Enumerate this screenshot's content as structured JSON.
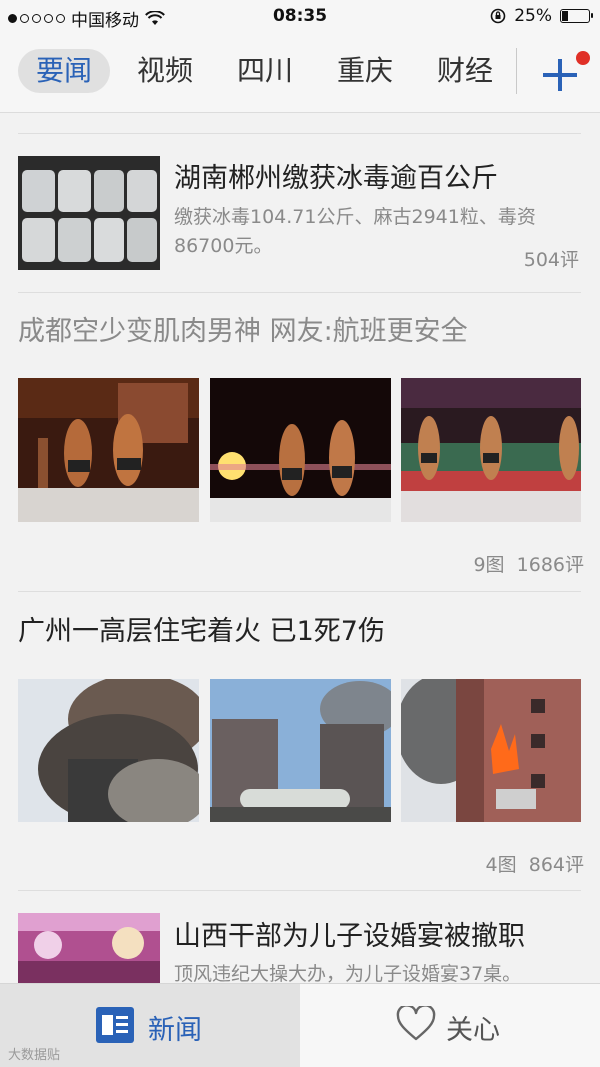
{
  "status_bar": {
    "carrier": "中国移动",
    "time": "08:35",
    "battery_percent": "25%",
    "battery_level": 0.25,
    "signal_dots_filled": 1
  },
  "tabs": [
    {
      "label": "要闻",
      "active": true
    },
    {
      "label": "视频"
    },
    {
      "label": "四川"
    },
    {
      "label": "重庆"
    },
    {
      "label": "财经"
    }
  ],
  "colors": {
    "accent": "#2a62b7",
    "badge": "#e03027"
  },
  "feed": {
    "item1": {
      "title": "湖南郴州缴获冰毒逾百公斤",
      "summary": "缴获冰毒104.71公斤、麻古2941粒、毒资86700元。",
      "comments": "504评"
    },
    "item2": {
      "title": "成都空少变肌肉男神 网友:航班更安全",
      "images": "9图",
      "comments": "1686评"
    },
    "item3": {
      "title": "广州一高层住宅着火 已1死7伤",
      "images": "4图",
      "comments": "864评"
    },
    "item4": {
      "title": "山西干部为儿子设婚宴被撤职",
      "summary": "顶风违纪大操大办，为儿子设婚宴37桌。"
    }
  },
  "bottom_nav": {
    "news_label": "新闻",
    "follow_label": "关心"
  },
  "watermark": "大数据贴"
}
